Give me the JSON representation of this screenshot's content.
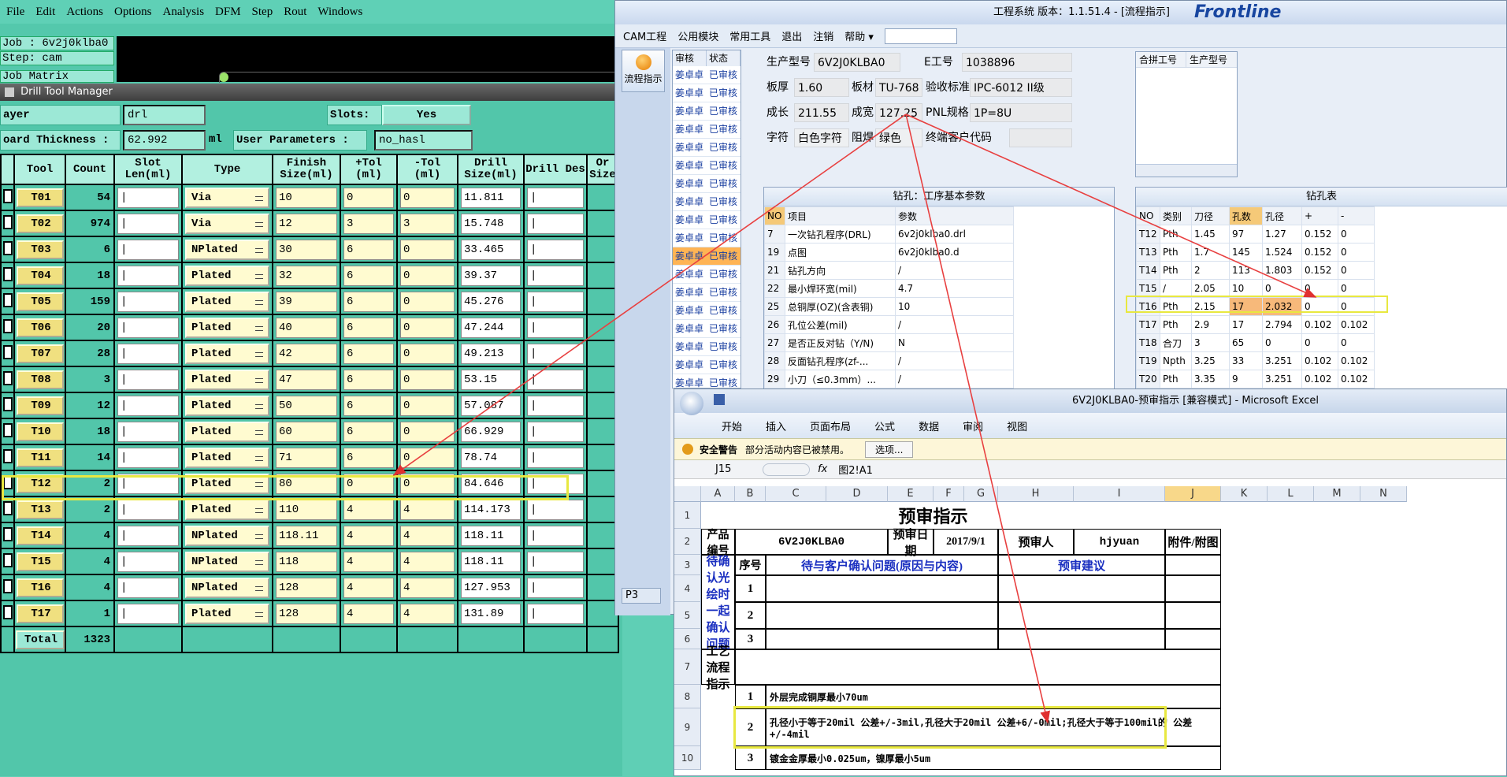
{
  "cam": {
    "menu": [
      "File",
      "Edit",
      "Actions",
      "Options",
      "Analysis",
      "DFM",
      "Step",
      "Rout",
      "Windows"
    ],
    "job": "Job : 6v2j0klba0",
    "step": "Step: cam",
    "job_matrix": "Job Matrix",
    "dtm_title": "Drill Tool Manager",
    "layer_label": "ayer",
    "layer_value": "drl",
    "slots_label": "Slots:",
    "slots_value": "Yes",
    "board_label": "oard Thickness :",
    "board_value": "62.992",
    "board_unit": "ml",
    "userparam_label": "User Parameters :",
    "userparam_value": "no_hasl",
    "headers": [
      "Tool",
      "Count",
      "Slot Len(ml)",
      "Type",
      "Finish Size(ml)",
      "+Tol (ml)",
      "-Tol (ml)",
      "Drill Size(ml)",
      "Drill Des",
      "Or Size"
    ],
    "rows": [
      {
        "tool": "T01",
        "count": "54",
        "type": "Via",
        "finish": "10",
        "ptol": "0",
        "mtol": "0",
        "drill": "11.811"
      },
      {
        "tool": "T02",
        "count": "974",
        "type": "Via",
        "finish": "12",
        "ptol": "3",
        "mtol": "3",
        "drill": "15.748"
      },
      {
        "tool": "T03",
        "count": "6",
        "type": "NPlated",
        "finish": "30",
        "ptol": "6",
        "mtol": "0",
        "drill": "33.465"
      },
      {
        "tool": "T04",
        "count": "18",
        "type": "Plated",
        "finish": "32",
        "ptol": "6",
        "mtol": "0",
        "drill": "39.37"
      },
      {
        "tool": "T05",
        "count": "159",
        "type": "Plated",
        "finish": "39",
        "ptol": "6",
        "mtol": "0",
        "drill": "45.276"
      },
      {
        "tool": "T06",
        "count": "20",
        "type": "Plated",
        "finish": "40",
        "ptol": "6",
        "mtol": "0",
        "drill": "47.244"
      },
      {
        "tool": "T07",
        "count": "28",
        "type": "Plated",
        "finish": "42",
        "ptol": "6",
        "mtol": "0",
        "drill": "49.213"
      },
      {
        "tool": "T08",
        "count": "3",
        "type": "Plated",
        "finish": "47",
        "ptol": "6",
        "mtol": "0",
        "drill": "53.15"
      },
      {
        "tool": "T09",
        "count": "12",
        "type": "Plated",
        "finish": "50",
        "ptol": "6",
        "mtol": "0",
        "drill": "57.087"
      },
      {
        "tool": "T10",
        "count": "18",
        "type": "Plated",
        "finish": "60",
        "ptol": "6",
        "mtol": "0",
        "drill": "66.929"
      },
      {
        "tool": "T11",
        "count": "14",
        "type": "Plated",
        "finish": "71",
        "ptol": "6",
        "mtol": "0",
        "drill": "78.74"
      },
      {
        "tool": "T12",
        "count": "2",
        "type": "Plated",
        "finish": "80",
        "ptol": "0",
        "mtol": "0",
        "drill": "84.646"
      },
      {
        "tool": "T13",
        "count": "2",
        "type": "Plated",
        "finish": "110",
        "ptol": "4",
        "mtol": "4",
        "drill": "114.173"
      },
      {
        "tool": "T14",
        "count": "4",
        "type": "NPlated",
        "finish": "118.11",
        "ptol": "4",
        "mtol": "4",
        "drill": "118.11"
      },
      {
        "tool": "T15",
        "count": "4",
        "type": "NPlated",
        "finish": "118",
        "ptol": "4",
        "mtol": "4",
        "drill": "118.11"
      },
      {
        "tool": "T16",
        "count": "4",
        "type": "NPlated",
        "finish": "128",
        "ptol": "4",
        "mtol": "4",
        "drill": "127.953"
      },
      {
        "tool": "T17",
        "count": "1",
        "type": "Plated",
        "finish": "128",
        "ptol": "4",
        "mtol": "4",
        "drill": "131.89"
      }
    ],
    "total_label": "Total",
    "total_count": "1323"
  },
  "erp": {
    "title": "工程系统  版本：1.1.51.4 - [流程指示]",
    "logo": "Frontline",
    "menu": [
      "CAM工程",
      "公用模块",
      "常用工具",
      "退出",
      "注销",
      "帮助 ▾"
    ],
    "flow_button": "流程指示",
    "page_tab": "P3",
    "audit_headers": [
      "审核",
      "状态"
    ],
    "audit_name": "姜卓卓",
    "audit_status": "已审核",
    "fields": {
      "model_label": "生产型号",
      "model": "6V2J0KLBA0",
      "eno_label": "E工号",
      "eno": "1038896",
      "thick_label": "板厚",
      "thick": "1.60",
      "mat_label": "板材",
      "mat": "TU-768",
      "std_label": "验收标准",
      "std": "IPC-6012 II级",
      "len_label": "成长",
      "len": "211.55",
      "wid_label": "成宽",
      "wid": "127.25",
      "pnl_label": "PNL规格",
      "pnl": "1P=8U",
      "char_label": "字符",
      "char": "白色字符",
      "mask_label": "阻焊",
      "mask": "绿色",
      "cust_label": "终端客户代码"
    },
    "merge_headers": [
      "合拼工号",
      "生产型号"
    ],
    "drill_params": {
      "title": "钻孔：工序基本参数",
      "headers": [
        "NO",
        "项目",
        "参数"
      ],
      "rows": [
        [
          "7",
          "一次钻孔程序(DRL)",
          "6v2j0klba0.drl"
        ],
        [
          "19",
          "点图",
          "6v2j0klba0.d"
        ],
        [
          "21",
          "钻孔方向",
          "/"
        ],
        [
          "22",
          "最小焊环宽(mil)",
          "4.7"
        ],
        [
          "25",
          "总铜厚(OZ)(含表铜)",
          "10"
        ],
        [
          "26",
          "孔位公差(mil)",
          "/"
        ],
        [
          "27",
          "是否正反对钻（Y/N)",
          "N"
        ],
        [
          "28",
          "反面钻孔程序(zf-...",
          "/"
        ],
        [
          "29",
          "小刀（≤0.3mm）...",
          "/"
        ]
      ]
    },
    "drill_table": {
      "title": "钻孔表",
      "headers": [
        "NO",
        "类别",
        "刀径",
        "孔数",
        "孔径",
        "+",
        "-"
      ],
      "rows": [
        [
          "T12",
          "Pth",
          "1.45",
          "97",
          "1.27",
          "0.152",
          "0"
        ],
        [
          "T13",
          "Pth",
          "1.7",
          "145",
          "1.524",
          "0.152",
          "0"
        ],
        [
          "T14",
          "Pth",
          "2",
          "113",
          "1.803",
          "0.152",
          "0"
        ],
        [
          "T15",
          "/",
          "2.05",
          "10",
          "0",
          "0",
          "0"
        ],
        [
          "T16",
          "Pth",
          "2.15",
          "17",
          "2.032",
          "0",
          "0"
        ],
        [
          "T17",
          "Pth",
          "2.9",
          "17",
          "2.794",
          "0.102",
          "0.102"
        ],
        [
          "T18",
          "合刀",
          "3",
          "65",
          "0",
          "0",
          "0"
        ],
        [
          "T19",
          "Npth",
          "3.25",
          "33",
          "3.251",
          "0.102",
          "0.102"
        ],
        [
          "T20",
          "Pth",
          "3.35",
          "9",
          "3.251",
          "0.102",
          "0.102"
        ]
      ]
    }
  },
  "excel": {
    "title": "6V2J0KLBA0-预审指示 [兼容模式] - Microsoft Excel",
    "tabs": [
      "开始",
      "插入",
      "页面布局",
      "公式",
      "数据",
      "审阅",
      "视图"
    ],
    "warn_label": "安全警告",
    "warn_text": "部分活动内容已被禁用。",
    "warn_button": "选项...",
    "namebox": "J15",
    "fx": "fx",
    "formula": "图2!A1",
    "columns": [
      "A",
      "B",
      "C",
      "D",
      "E",
      "F",
      "G",
      "H",
      "I",
      "J",
      "K",
      "L",
      "M",
      "N"
    ],
    "row_numbers": [
      "1",
      "2",
      "3",
      "4",
      "5",
      "6",
      "7",
      "8",
      "9",
      "10"
    ],
    "sheet_title": "预审指示",
    "product_no_label": "产品编号",
    "product_no": "6V2J0KLBA0",
    "date_label": "预审日期",
    "date": "2017/9/1",
    "reviewer_label": "预审人",
    "reviewer": "hjyuan",
    "attach_label": "附件/附图",
    "seq_label": "序号",
    "issue_label": "待与客户确认问题(原因与内容)",
    "suggest_label": "预审建议",
    "pending_label": "待确认光绘时一起确认问题",
    "process_label": "工艺流程指示",
    "items": [
      {
        "no": "1",
        "text": ""
      },
      {
        "no": "2",
        "text": ""
      },
      {
        "no": "3",
        "text": ""
      }
    ],
    "process_items": [
      {
        "no": "1",
        "text": "外层完成铜厚最小70um"
      },
      {
        "no": "2",
        "text": "孔径小于等于20mil 公差+/-3mil,孔径大于20mil 公差+6/-0mil;孔径大于等于100mil的 公差+/-4mil"
      },
      {
        "no": "3",
        "text": "镀金金厚最小0.025um，镍厚最小5um"
      }
    ]
  }
}
